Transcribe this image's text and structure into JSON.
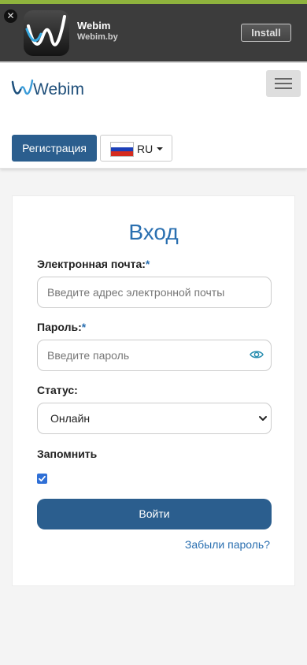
{
  "banner": {
    "close_glyph": "✕",
    "app_name": "Webim",
    "app_source": "Webim.by",
    "install_label": "Install",
    "icon": "webim-app-icon"
  },
  "header": {
    "logo_text": "Webim",
    "menu_icon": "hamburger-icon",
    "register_label": "Регистрация",
    "language": {
      "flag": "russia-flag-icon",
      "code": "RU"
    }
  },
  "login": {
    "title": "Вход",
    "email": {
      "label": "Электронная почта:",
      "required_mark": "*",
      "placeholder": "Введите адрес электронной почты",
      "value": ""
    },
    "password": {
      "label": "Пароль:",
      "required_mark": "*",
      "placeholder": "Введите пароль",
      "value": "",
      "toggle_icon": "eye-icon"
    },
    "status": {
      "label": "Статус:",
      "selected": "Онлайн"
    },
    "remember": {
      "label": "Запомнить",
      "checked": true
    },
    "submit_label": "Войти",
    "forgot_label": "Забыли пароль?"
  },
  "colors": {
    "brand_blue": "#2b5e8e",
    "link_blue": "#2a6fb0",
    "banner_green": "#8fb33d",
    "eye_icon_teal": "#2a8fb0"
  }
}
